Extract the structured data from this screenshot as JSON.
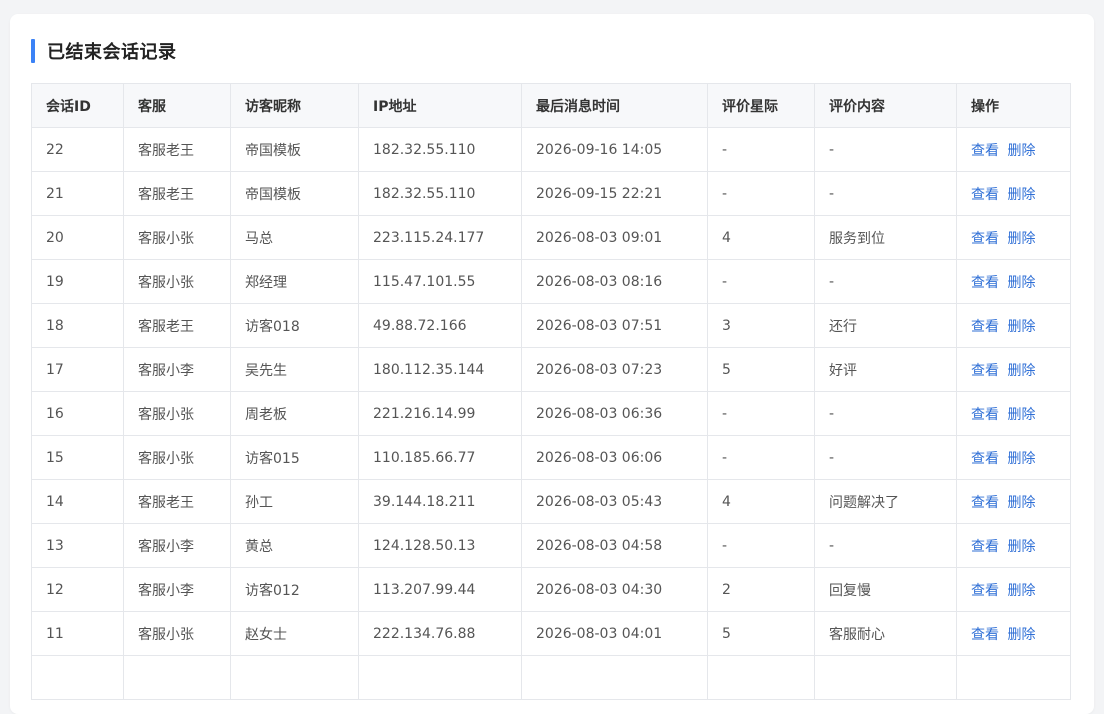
{
  "page": {
    "title": "已结束会话记录",
    "accent_color": "#3b82f6",
    "link_color": "#2f6fd6"
  },
  "table": {
    "columns": [
      "会话ID",
      "客服",
      "访客昵称",
      "IP地址",
      "最后消息时间",
      "评价星际",
      "评价内容",
      "操作"
    ],
    "action_labels": {
      "view": "查看",
      "delete": "删除"
    },
    "rows": [
      {
        "id": "22",
        "agent": "客服老王",
        "visitor": "帝国模板",
        "ip": "182.32.55.110",
        "time": "2026-09-16 14:05",
        "rating": "-",
        "comment": "-"
      },
      {
        "id": "21",
        "agent": "客服老王",
        "visitor": "帝国模板",
        "ip": "182.32.55.110",
        "time": "2026-09-15 22:21",
        "rating": "-",
        "comment": "-"
      },
      {
        "id": "20",
        "agent": "客服小张",
        "visitor": "马总",
        "ip": "223.115.24.177",
        "time": "2026-08-03 09:01",
        "rating": "4",
        "comment": "服务到位"
      },
      {
        "id": "19",
        "agent": "客服小张",
        "visitor": "郑经理",
        "ip": "115.47.101.55",
        "time": "2026-08-03 08:16",
        "rating": "-",
        "comment": "-"
      },
      {
        "id": "18",
        "agent": "客服老王",
        "visitor": "访客018",
        "ip": "49.88.72.166",
        "time": "2026-08-03 07:51",
        "rating": "3",
        "comment": "还行"
      },
      {
        "id": "17",
        "agent": "客服小李",
        "visitor": "吴先生",
        "ip": "180.112.35.144",
        "time": "2026-08-03 07:23",
        "rating": "5",
        "comment": "好评"
      },
      {
        "id": "16",
        "agent": "客服小张",
        "visitor": "周老板",
        "ip": "221.216.14.99",
        "time": "2026-08-03 06:36",
        "rating": "-",
        "comment": "-"
      },
      {
        "id": "15",
        "agent": "客服小张",
        "visitor": "访客015",
        "ip": "110.185.66.77",
        "time": "2026-08-03 06:06",
        "rating": "-",
        "comment": "-"
      },
      {
        "id": "14",
        "agent": "客服老王",
        "visitor": "孙工",
        "ip": "39.144.18.211",
        "time": "2026-08-03 05:43",
        "rating": "4",
        "comment": "问题解决了"
      },
      {
        "id": "13",
        "agent": "客服小李",
        "visitor": "黄总",
        "ip": "124.128.50.13",
        "time": "2026-08-03 04:58",
        "rating": "-",
        "comment": "-"
      },
      {
        "id": "12",
        "agent": "客服小李",
        "visitor": "访客012",
        "ip": "113.207.99.44",
        "time": "2026-08-03 04:30",
        "rating": "2",
        "comment": "回复慢"
      },
      {
        "id": "11",
        "agent": "客服小张",
        "visitor": "赵女士",
        "ip": "222.134.76.88",
        "time": "2026-08-03 04:01",
        "rating": "5",
        "comment": "客服耐心"
      },
      {
        "id": "",
        "agent": "",
        "visitor": "",
        "ip": "",
        "time": "",
        "rating": "",
        "comment": ""
      }
    ]
  }
}
